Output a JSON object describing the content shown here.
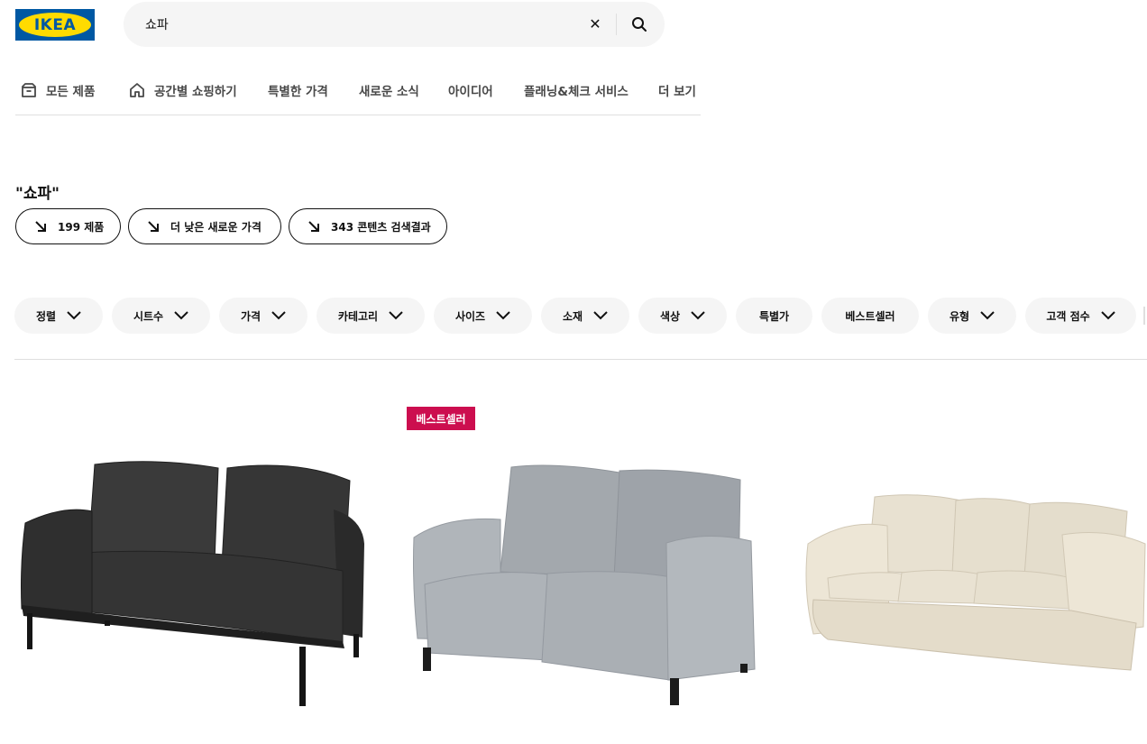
{
  "header": {
    "logo_text": "IKEA",
    "search": {
      "value": "쇼파",
      "placeholder": ""
    }
  },
  "nav": {
    "items": [
      {
        "label": "모든 제품",
        "icon": "box-icon"
      },
      {
        "label": "공간별 쇼핑하기",
        "icon": "home-icon"
      },
      {
        "label": "특별한 가격"
      },
      {
        "label": "새로운 소식"
      },
      {
        "label": "아이디어"
      },
      {
        "label": "플래닝&체크 서비스"
      },
      {
        "label": "더 보기"
      }
    ]
  },
  "results": {
    "query_title": "\"쇼파\"",
    "pills": [
      {
        "label": "199 제품"
      },
      {
        "label": "더 낮은 새로운 가격"
      },
      {
        "label": "343 콘텐츠 검색결과"
      }
    ]
  },
  "filters": [
    {
      "label": "정렬",
      "dropdown": true
    },
    {
      "label": "시트수",
      "dropdown": true
    },
    {
      "label": "가격",
      "dropdown": true
    },
    {
      "label": "카테고리",
      "dropdown": true
    },
    {
      "label": "사이즈",
      "dropdown": true
    },
    {
      "label": "소재",
      "dropdown": true
    },
    {
      "label": "색상",
      "dropdown": true
    },
    {
      "label": "특별가",
      "dropdown": false
    },
    {
      "label": "베스트셀러",
      "dropdown": false
    },
    {
      "label": "유형",
      "dropdown": true
    },
    {
      "label": "고객 점수",
      "dropdown": true
    }
  ],
  "products": [
    {
      "color": "#2e2e2e",
      "badge": ""
    },
    {
      "color": "#a6abb1",
      "badge": "베스트셀러"
    },
    {
      "color": "#e3dccb",
      "badge": ""
    }
  ],
  "colors": {
    "brand_blue": "#0058a3",
    "brand_yellow": "#ffdb00",
    "badge_red": "#cc0e4f"
  }
}
